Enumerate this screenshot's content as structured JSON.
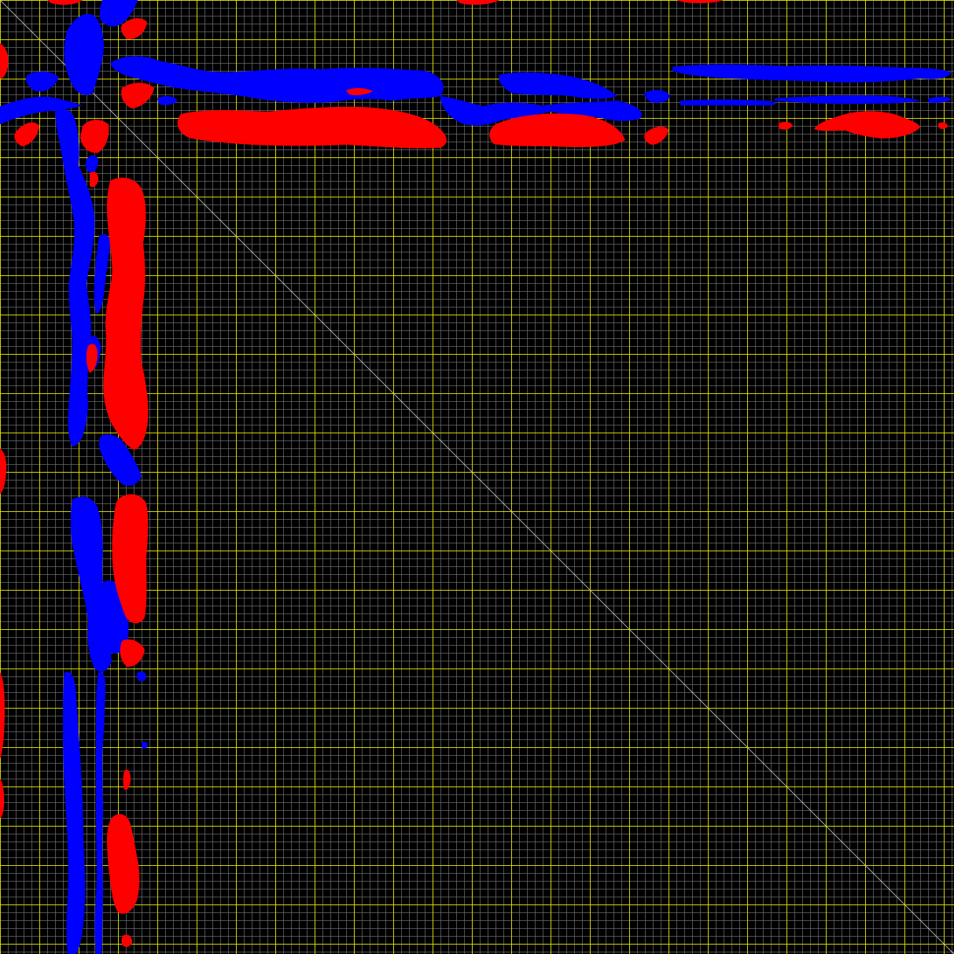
{
  "view": {
    "type": "symmetric contour map",
    "colors": {
      "background": "#000000",
      "minor_grid": "#6a6a6a",
      "major_grid": "#e6e600",
      "diagonal": "#cfcfcf",
      "positive_level": "#ff0000",
      "negative_level": "#0000ff"
    },
    "grid": {
      "minor": true,
      "major": true
    },
    "legend": "none",
    "labels": "none"
  }
}
